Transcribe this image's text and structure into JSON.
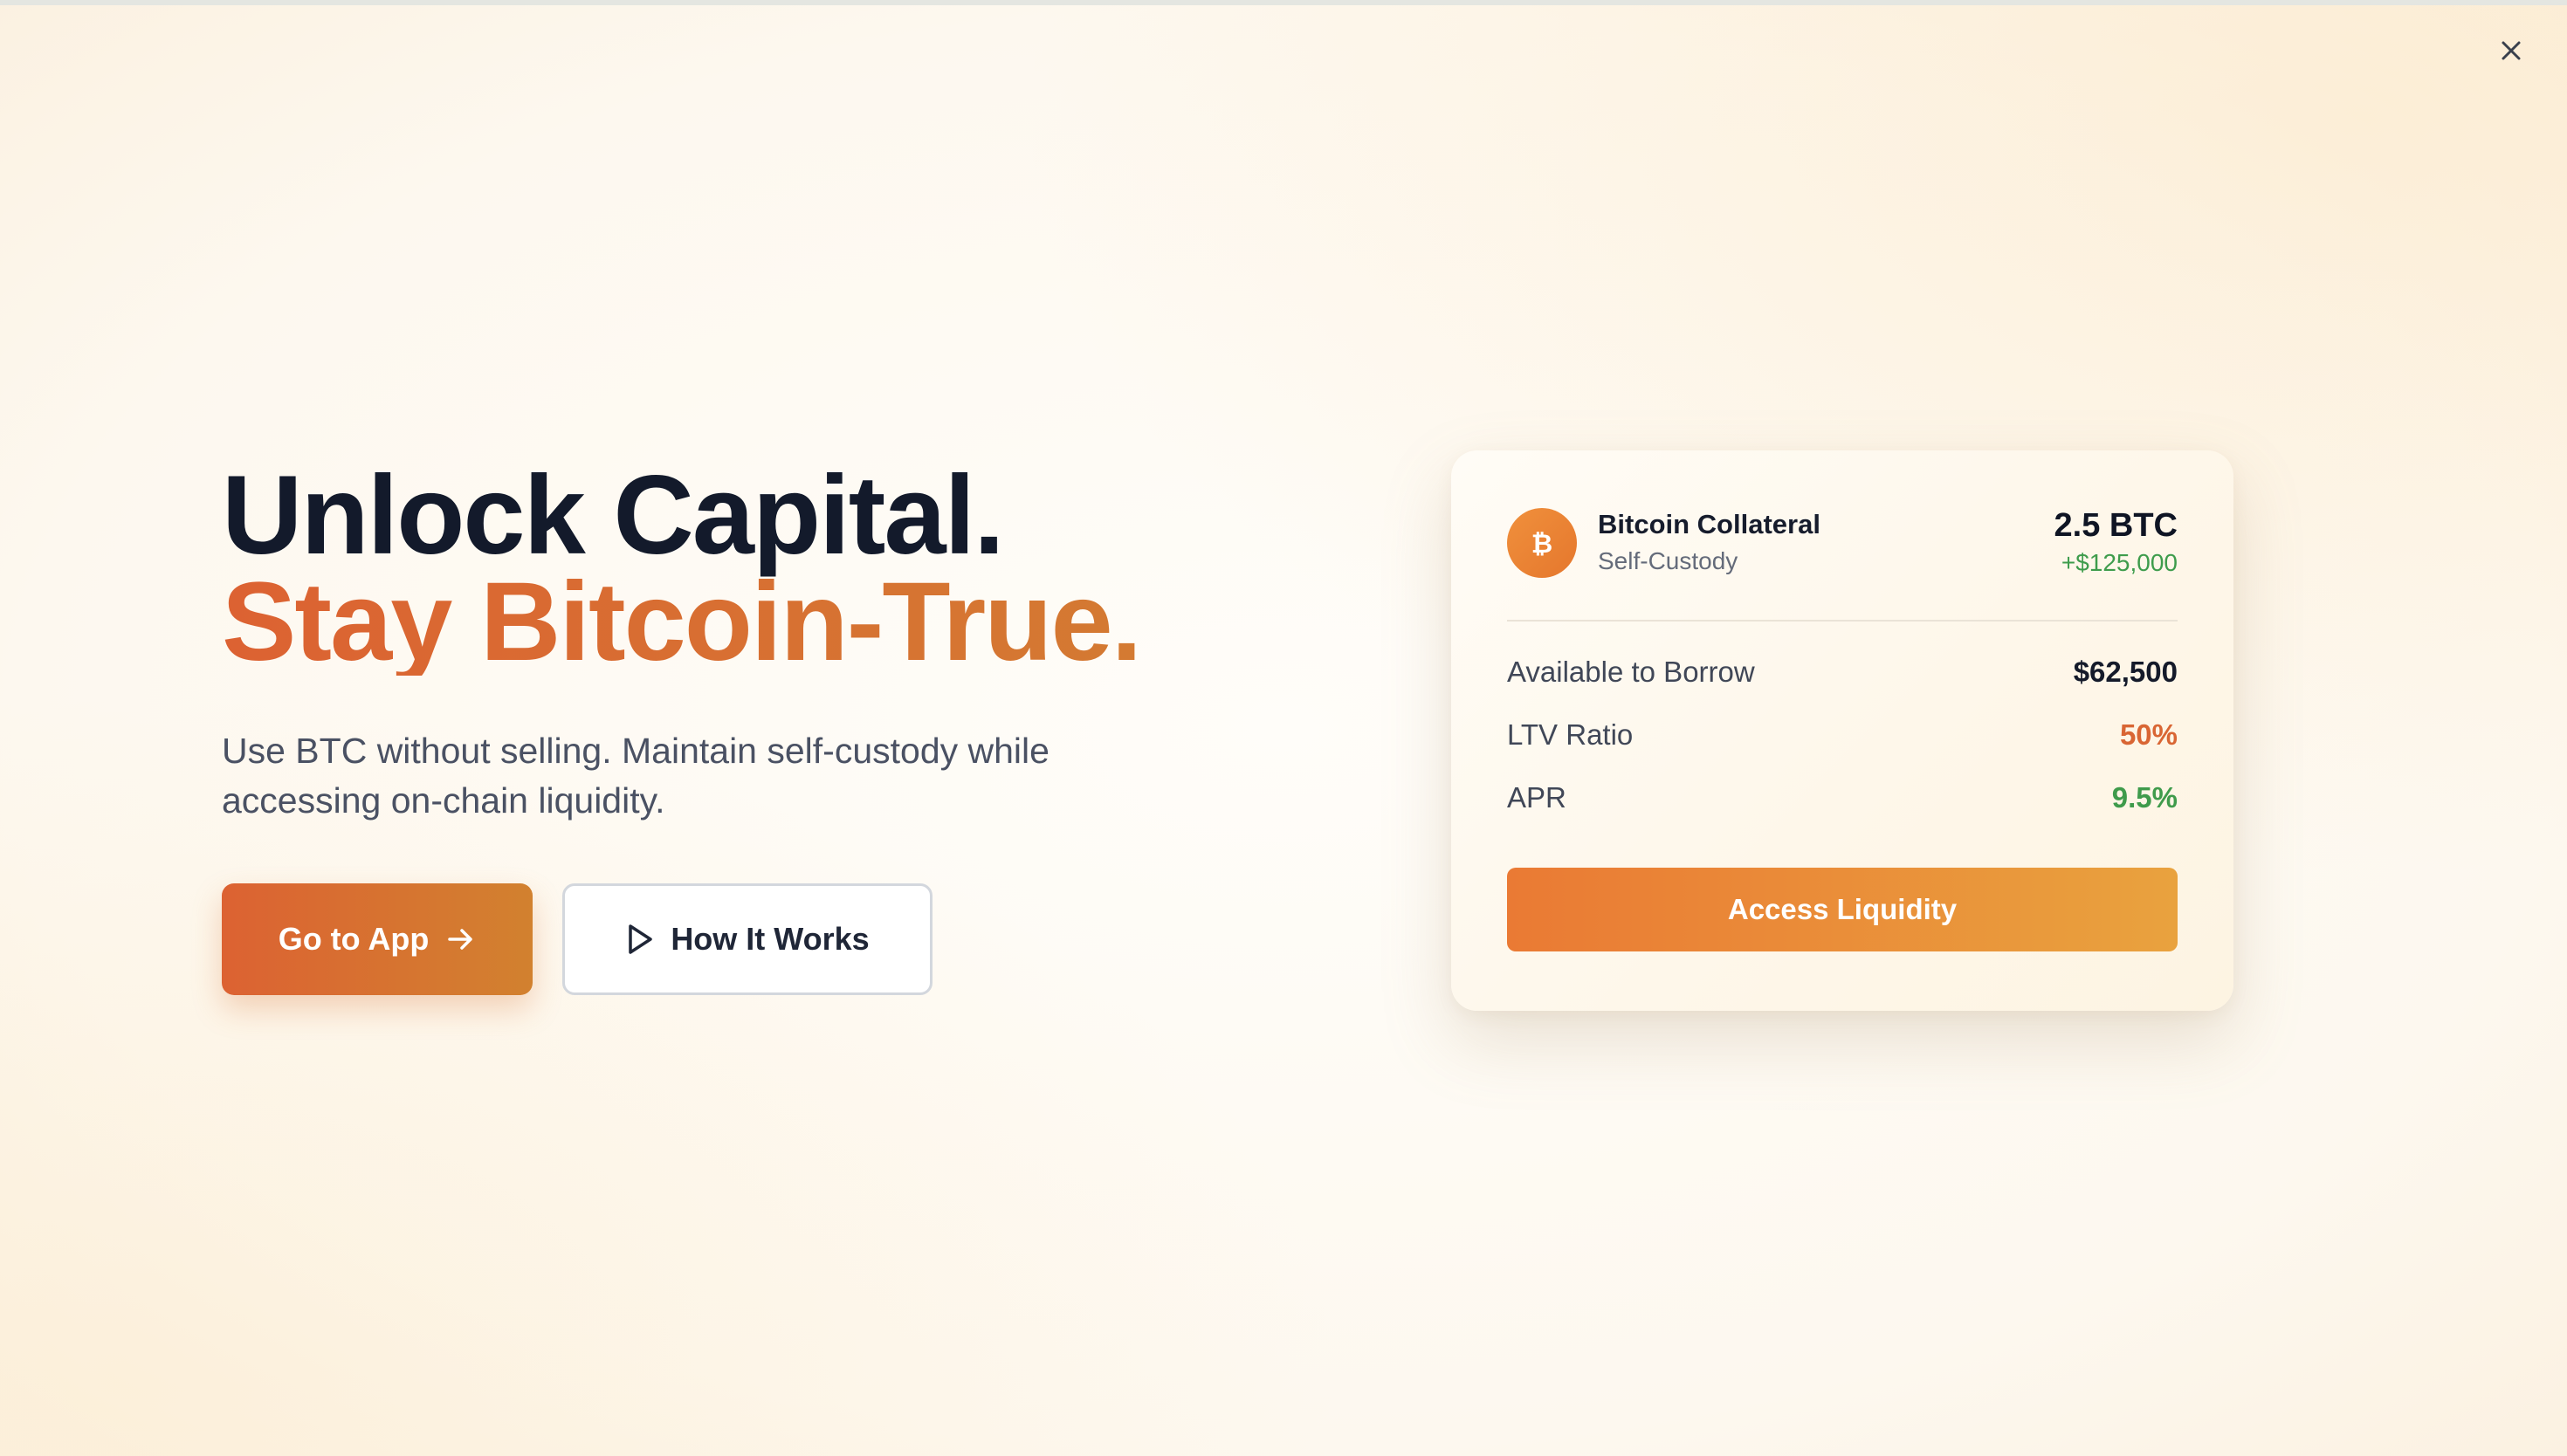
{
  "hero": {
    "headline_line1": "Unlock Capital.",
    "headline_line2": "Stay Bitcoin-True.",
    "subtitle": "Use BTC without selling. Maintain self-custody while accessing on-chain liquidity.",
    "primary_button_label": "Go to App",
    "secondary_button_label": "How It Works"
  },
  "card": {
    "coin_symbol": "₿",
    "title": "Bitcoin Collateral",
    "subtitle": "Self-Custody",
    "amount": "2.5 BTC",
    "value_change": "+$125,000",
    "stats": [
      {
        "label": "Available to Borrow",
        "value": "$62,500"
      },
      {
        "label": "LTV Ratio",
        "value": "50%"
      },
      {
        "label": "APR",
        "value": "9.5%"
      }
    ],
    "action_label": "Access Liquidity"
  },
  "icons": {
    "close": "close-icon",
    "arrow": "arrow-right-icon",
    "play": "play-icon",
    "bitcoin": "bitcoin-icon"
  },
  "colors": {
    "accent_orange": "#dc6232",
    "accent_gold": "#e9a23e",
    "positive_green": "#3f9b4b",
    "heading_navy": "#131a2b"
  }
}
